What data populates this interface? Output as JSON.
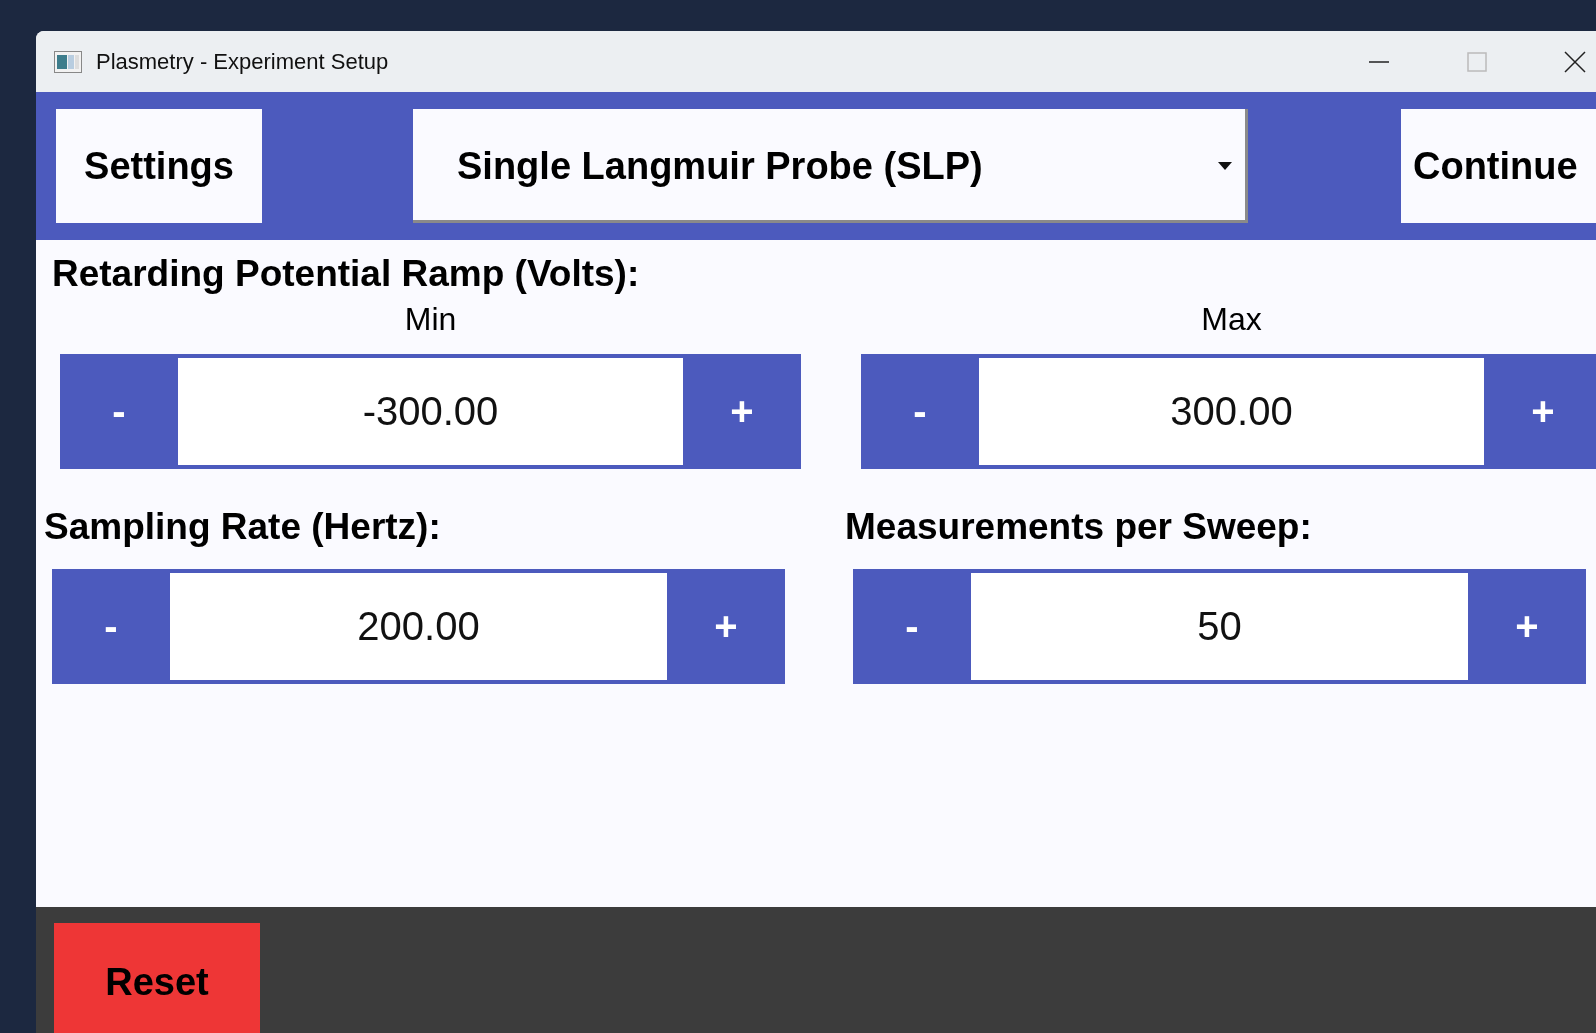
{
  "window": {
    "title": "Plasmetry - Experiment Setup"
  },
  "toolbar": {
    "settings_button": "Settings",
    "mode_dropdown": {
      "value": "Single Langmuir Probe (SLP)"
    },
    "continue_button": "Continue"
  },
  "ramp": {
    "heading": "Retarding Potential Ramp (Volts):",
    "fields": [
      {
        "label": "Min",
        "decrement": "-",
        "value": "-300.00",
        "increment": "+"
      },
      {
        "label": "Max",
        "decrement": "-",
        "value": "300.00",
        "increment": "+"
      }
    ]
  },
  "parameters": [
    {
      "heading": "Sampling Rate (Hertz):",
      "decrement": "-",
      "value": "200.00",
      "increment": "+"
    },
    {
      "heading": "Measurements per Sweep:",
      "decrement": "-",
      "value": "50",
      "increment": "+"
    }
  ],
  "footer": {
    "reset_button": "Reset"
  }
}
